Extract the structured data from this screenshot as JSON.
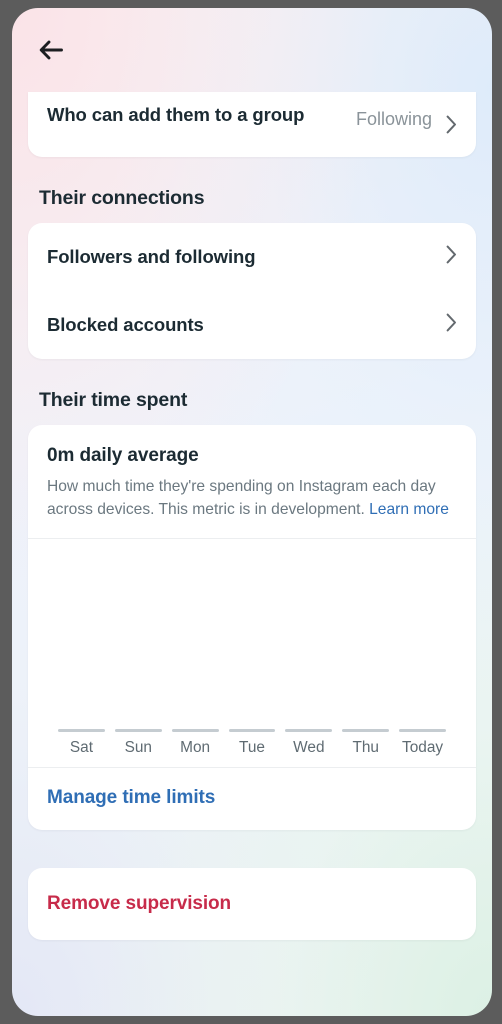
{
  "header": {
    "back_icon": "arrow-left-icon"
  },
  "privacy_card": {
    "rows": [
      {
        "title": "Who can add them to a group",
        "value": "Following",
        "chevron": "chevron-right-icon"
      }
    ]
  },
  "connections": {
    "heading": "Their connections",
    "rows": [
      {
        "title": "Followers and following",
        "chevron": "chevron-right-icon"
      },
      {
        "title": "Blocked accounts",
        "chevron": "chevron-right-icon"
      }
    ]
  },
  "time_spent": {
    "heading": "Their time spent",
    "average": "0m daily average",
    "description": "How much time they're spending on Instagram each day across devices. This metric is in development.",
    "learn_more": "Learn more",
    "manage_link": "Manage time limits"
  },
  "danger": {
    "remove_label": "Remove supervision"
  },
  "colors": {
    "link_blue": "#2f6eb5",
    "danger_red": "#c72b4a",
    "text_primary": "#1c2b33",
    "text_secondary": "#6b7880",
    "bar_gray": "#c5ccd1"
  },
  "chart_data": {
    "type": "bar",
    "title": "0m daily average",
    "categories": [
      "Sat",
      "Sun",
      "Mon",
      "Tue",
      "Wed",
      "Thu",
      "Today"
    ],
    "values": [
      0,
      0,
      0,
      0,
      0,
      0,
      0
    ],
    "unit": "minutes",
    "xlabel": "",
    "ylabel": "",
    "ylim": [
      0,
      0
    ],
    "grid": false,
    "legend": false
  }
}
